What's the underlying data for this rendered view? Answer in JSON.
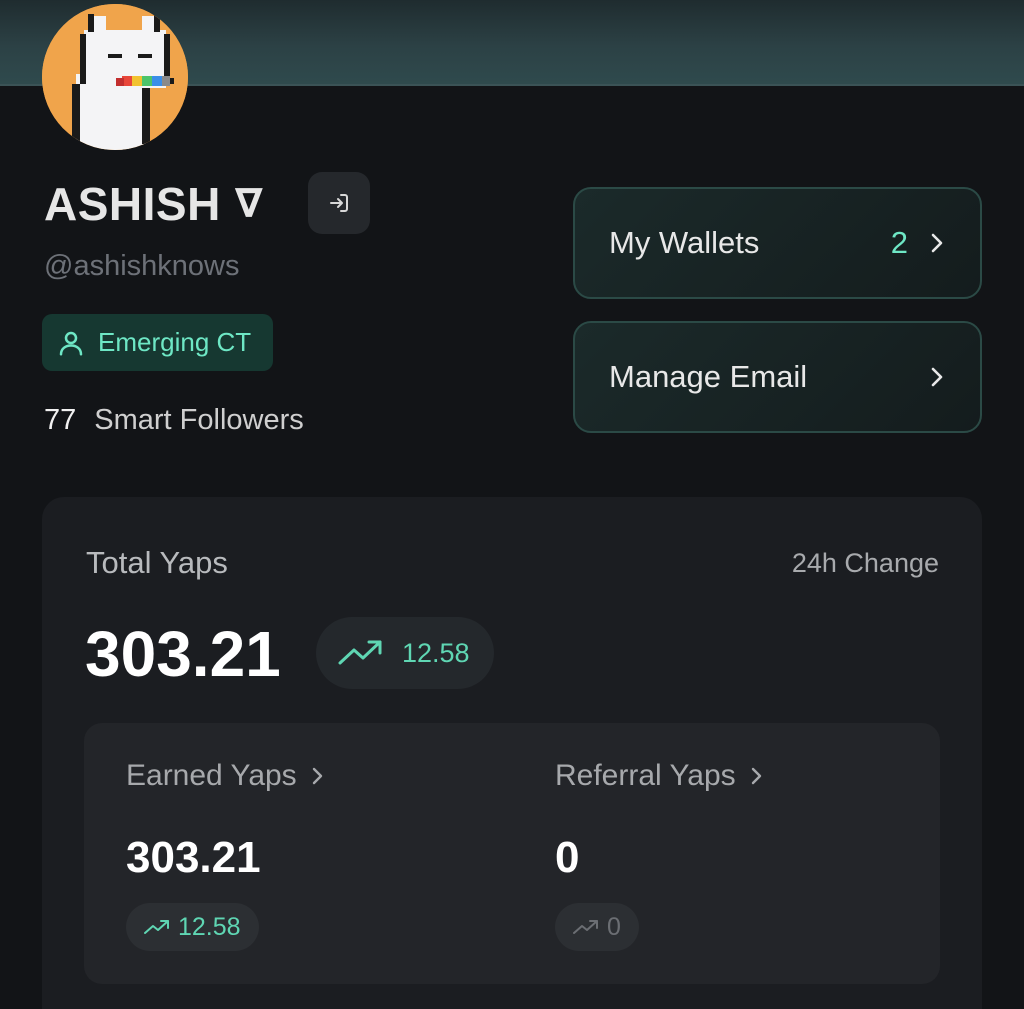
{
  "profile": {
    "name": "ASHISH",
    "name_badge": "∇",
    "handle": "@ashishknows",
    "tier": "Emerging CT",
    "followers_count": "77",
    "followers_label": "Smart Followers"
  },
  "actions": {
    "wallets_label": "My Wallets",
    "wallets_count": "2",
    "email_label": "Manage Email"
  },
  "stats": {
    "total_label": "Total Yaps",
    "change_label": "24h Change",
    "total_value": "303.21",
    "total_change": "12.58",
    "earned_label": "Earned Yaps",
    "earned_value": "303.21",
    "earned_change": "12.58",
    "referral_label": "Referral Yaps",
    "referral_value": "0",
    "referral_change": "0"
  },
  "colors": {
    "accent": "#6ee7c5",
    "background": "#121417",
    "card": "#1b1d21"
  },
  "icons": {
    "logout": "logout-icon",
    "tier": "user-icon",
    "chevron": "chevron-right-icon",
    "trend": "trending-up-icon"
  }
}
